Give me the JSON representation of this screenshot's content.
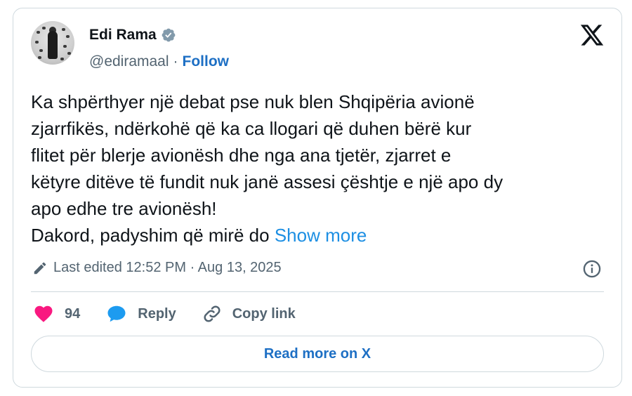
{
  "author": {
    "name": "Edi Rama",
    "handle": "@ediramaal",
    "separator": "·",
    "follow_label": "Follow"
  },
  "tweet": {
    "lines": [
      "Ka shpërthyer një debat pse nuk blen Shqipëria avionë",
      "zjarrfikës, ndërkohë që ka ca llogari që duhen bërë kur",
      "flitet për blerje avionësh dhe nga ana tjetër, zjarret e",
      "këtyre ditëve të fundit nuk janë assesi çështje e një apo dy",
      "apo edhe tre avionësh!"
    ],
    "last_line": "Dakord, padyshim që mirë do",
    "show_more_label": "Show more"
  },
  "meta": {
    "edited_text": "Last edited 12:52 PM · Aug 13, 2025"
  },
  "actions": {
    "likes_count": "94",
    "reply_label": "Reply",
    "copy_link_label": "Copy link"
  },
  "read_more_label": "Read more on X",
  "colors": {
    "link": "#1d6fc4",
    "show_more": "#1d8fe3",
    "heart": "#f91880",
    "reply_bubble": "#1d9bf0",
    "verified": "#829aab",
    "muted": "#536471"
  },
  "icons": [
    "verified-badge-icon",
    "x-logo-icon",
    "pencil-icon",
    "info-icon",
    "heart-icon",
    "reply-bubble-icon",
    "link-icon"
  ]
}
